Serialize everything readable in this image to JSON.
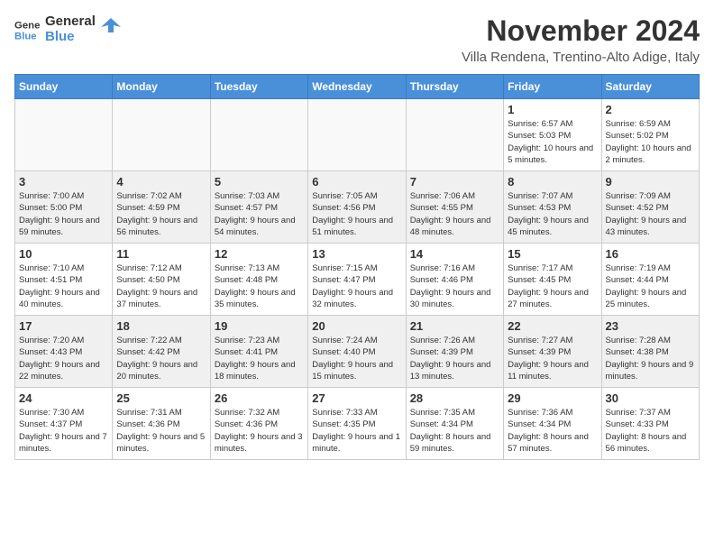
{
  "logo": {
    "line1": "General",
    "line2": "Blue"
  },
  "title": "November 2024",
  "subtitle": "Villa Rendena, Trentino-Alto Adige, Italy",
  "days_of_week": [
    "Sunday",
    "Monday",
    "Tuesday",
    "Wednesday",
    "Thursday",
    "Friday",
    "Saturday"
  ],
  "weeks": [
    {
      "shade": "white",
      "days": [
        {
          "num": "",
          "info": ""
        },
        {
          "num": "",
          "info": ""
        },
        {
          "num": "",
          "info": ""
        },
        {
          "num": "",
          "info": ""
        },
        {
          "num": "",
          "info": ""
        },
        {
          "num": "1",
          "info": "Sunrise: 6:57 AM\nSunset: 5:03 PM\nDaylight: 10 hours and 5 minutes."
        },
        {
          "num": "2",
          "info": "Sunrise: 6:59 AM\nSunset: 5:02 PM\nDaylight: 10 hours and 2 minutes."
        }
      ]
    },
    {
      "shade": "gray",
      "days": [
        {
          "num": "3",
          "info": "Sunrise: 7:00 AM\nSunset: 5:00 PM\nDaylight: 9 hours and 59 minutes."
        },
        {
          "num": "4",
          "info": "Sunrise: 7:02 AM\nSunset: 4:59 PM\nDaylight: 9 hours and 56 minutes."
        },
        {
          "num": "5",
          "info": "Sunrise: 7:03 AM\nSunset: 4:57 PM\nDaylight: 9 hours and 54 minutes."
        },
        {
          "num": "6",
          "info": "Sunrise: 7:05 AM\nSunset: 4:56 PM\nDaylight: 9 hours and 51 minutes."
        },
        {
          "num": "7",
          "info": "Sunrise: 7:06 AM\nSunset: 4:55 PM\nDaylight: 9 hours and 48 minutes."
        },
        {
          "num": "8",
          "info": "Sunrise: 7:07 AM\nSunset: 4:53 PM\nDaylight: 9 hours and 45 minutes."
        },
        {
          "num": "9",
          "info": "Sunrise: 7:09 AM\nSunset: 4:52 PM\nDaylight: 9 hours and 43 minutes."
        }
      ]
    },
    {
      "shade": "white",
      "days": [
        {
          "num": "10",
          "info": "Sunrise: 7:10 AM\nSunset: 4:51 PM\nDaylight: 9 hours and 40 minutes."
        },
        {
          "num": "11",
          "info": "Sunrise: 7:12 AM\nSunset: 4:50 PM\nDaylight: 9 hours and 37 minutes."
        },
        {
          "num": "12",
          "info": "Sunrise: 7:13 AM\nSunset: 4:48 PM\nDaylight: 9 hours and 35 minutes."
        },
        {
          "num": "13",
          "info": "Sunrise: 7:15 AM\nSunset: 4:47 PM\nDaylight: 9 hours and 32 minutes."
        },
        {
          "num": "14",
          "info": "Sunrise: 7:16 AM\nSunset: 4:46 PM\nDaylight: 9 hours and 30 minutes."
        },
        {
          "num": "15",
          "info": "Sunrise: 7:17 AM\nSunset: 4:45 PM\nDaylight: 9 hours and 27 minutes."
        },
        {
          "num": "16",
          "info": "Sunrise: 7:19 AM\nSunset: 4:44 PM\nDaylight: 9 hours and 25 minutes."
        }
      ]
    },
    {
      "shade": "gray",
      "days": [
        {
          "num": "17",
          "info": "Sunrise: 7:20 AM\nSunset: 4:43 PM\nDaylight: 9 hours and 22 minutes."
        },
        {
          "num": "18",
          "info": "Sunrise: 7:22 AM\nSunset: 4:42 PM\nDaylight: 9 hours and 20 minutes."
        },
        {
          "num": "19",
          "info": "Sunrise: 7:23 AM\nSunset: 4:41 PM\nDaylight: 9 hours and 18 minutes."
        },
        {
          "num": "20",
          "info": "Sunrise: 7:24 AM\nSunset: 4:40 PM\nDaylight: 9 hours and 15 minutes."
        },
        {
          "num": "21",
          "info": "Sunrise: 7:26 AM\nSunset: 4:39 PM\nDaylight: 9 hours and 13 minutes."
        },
        {
          "num": "22",
          "info": "Sunrise: 7:27 AM\nSunset: 4:39 PM\nDaylight: 9 hours and 11 minutes."
        },
        {
          "num": "23",
          "info": "Sunrise: 7:28 AM\nSunset: 4:38 PM\nDaylight: 9 hours and 9 minutes."
        }
      ]
    },
    {
      "shade": "white",
      "days": [
        {
          "num": "24",
          "info": "Sunrise: 7:30 AM\nSunset: 4:37 PM\nDaylight: 9 hours and 7 minutes."
        },
        {
          "num": "25",
          "info": "Sunrise: 7:31 AM\nSunset: 4:36 PM\nDaylight: 9 hours and 5 minutes."
        },
        {
          "num": "26",
          "info": "Sunrise: 7:32 AM\nSunset: 4:36 PM\nDaylight: 9 hours and 3 minutes."
        },
        {
          "num": "27",
          "info": "Sunrise: 7:33 AM\nSunset: 4:35 PM\nDaylight: 9 hours and 1 minute."
        },
        {
          "num": "28",
          "info": "Sunrise: 7:35 AM\nSunset: 4:34 PM\nDaylight: 8 hours and 59 minutes."
        },
        {
          "num": "29",
          "info": "Sunrise: 7:36 AM\nSunset: 4:34 PM\nDaylight: 8 hours and 57 minutes."
        },
        {
          "num": "30",
          "info": "Sunrise: 7:37 AM\nSunset: 4:33 PM\nDaylight: 8 hours and 56 minutes."
        }
      ]
    }
  ]
}
